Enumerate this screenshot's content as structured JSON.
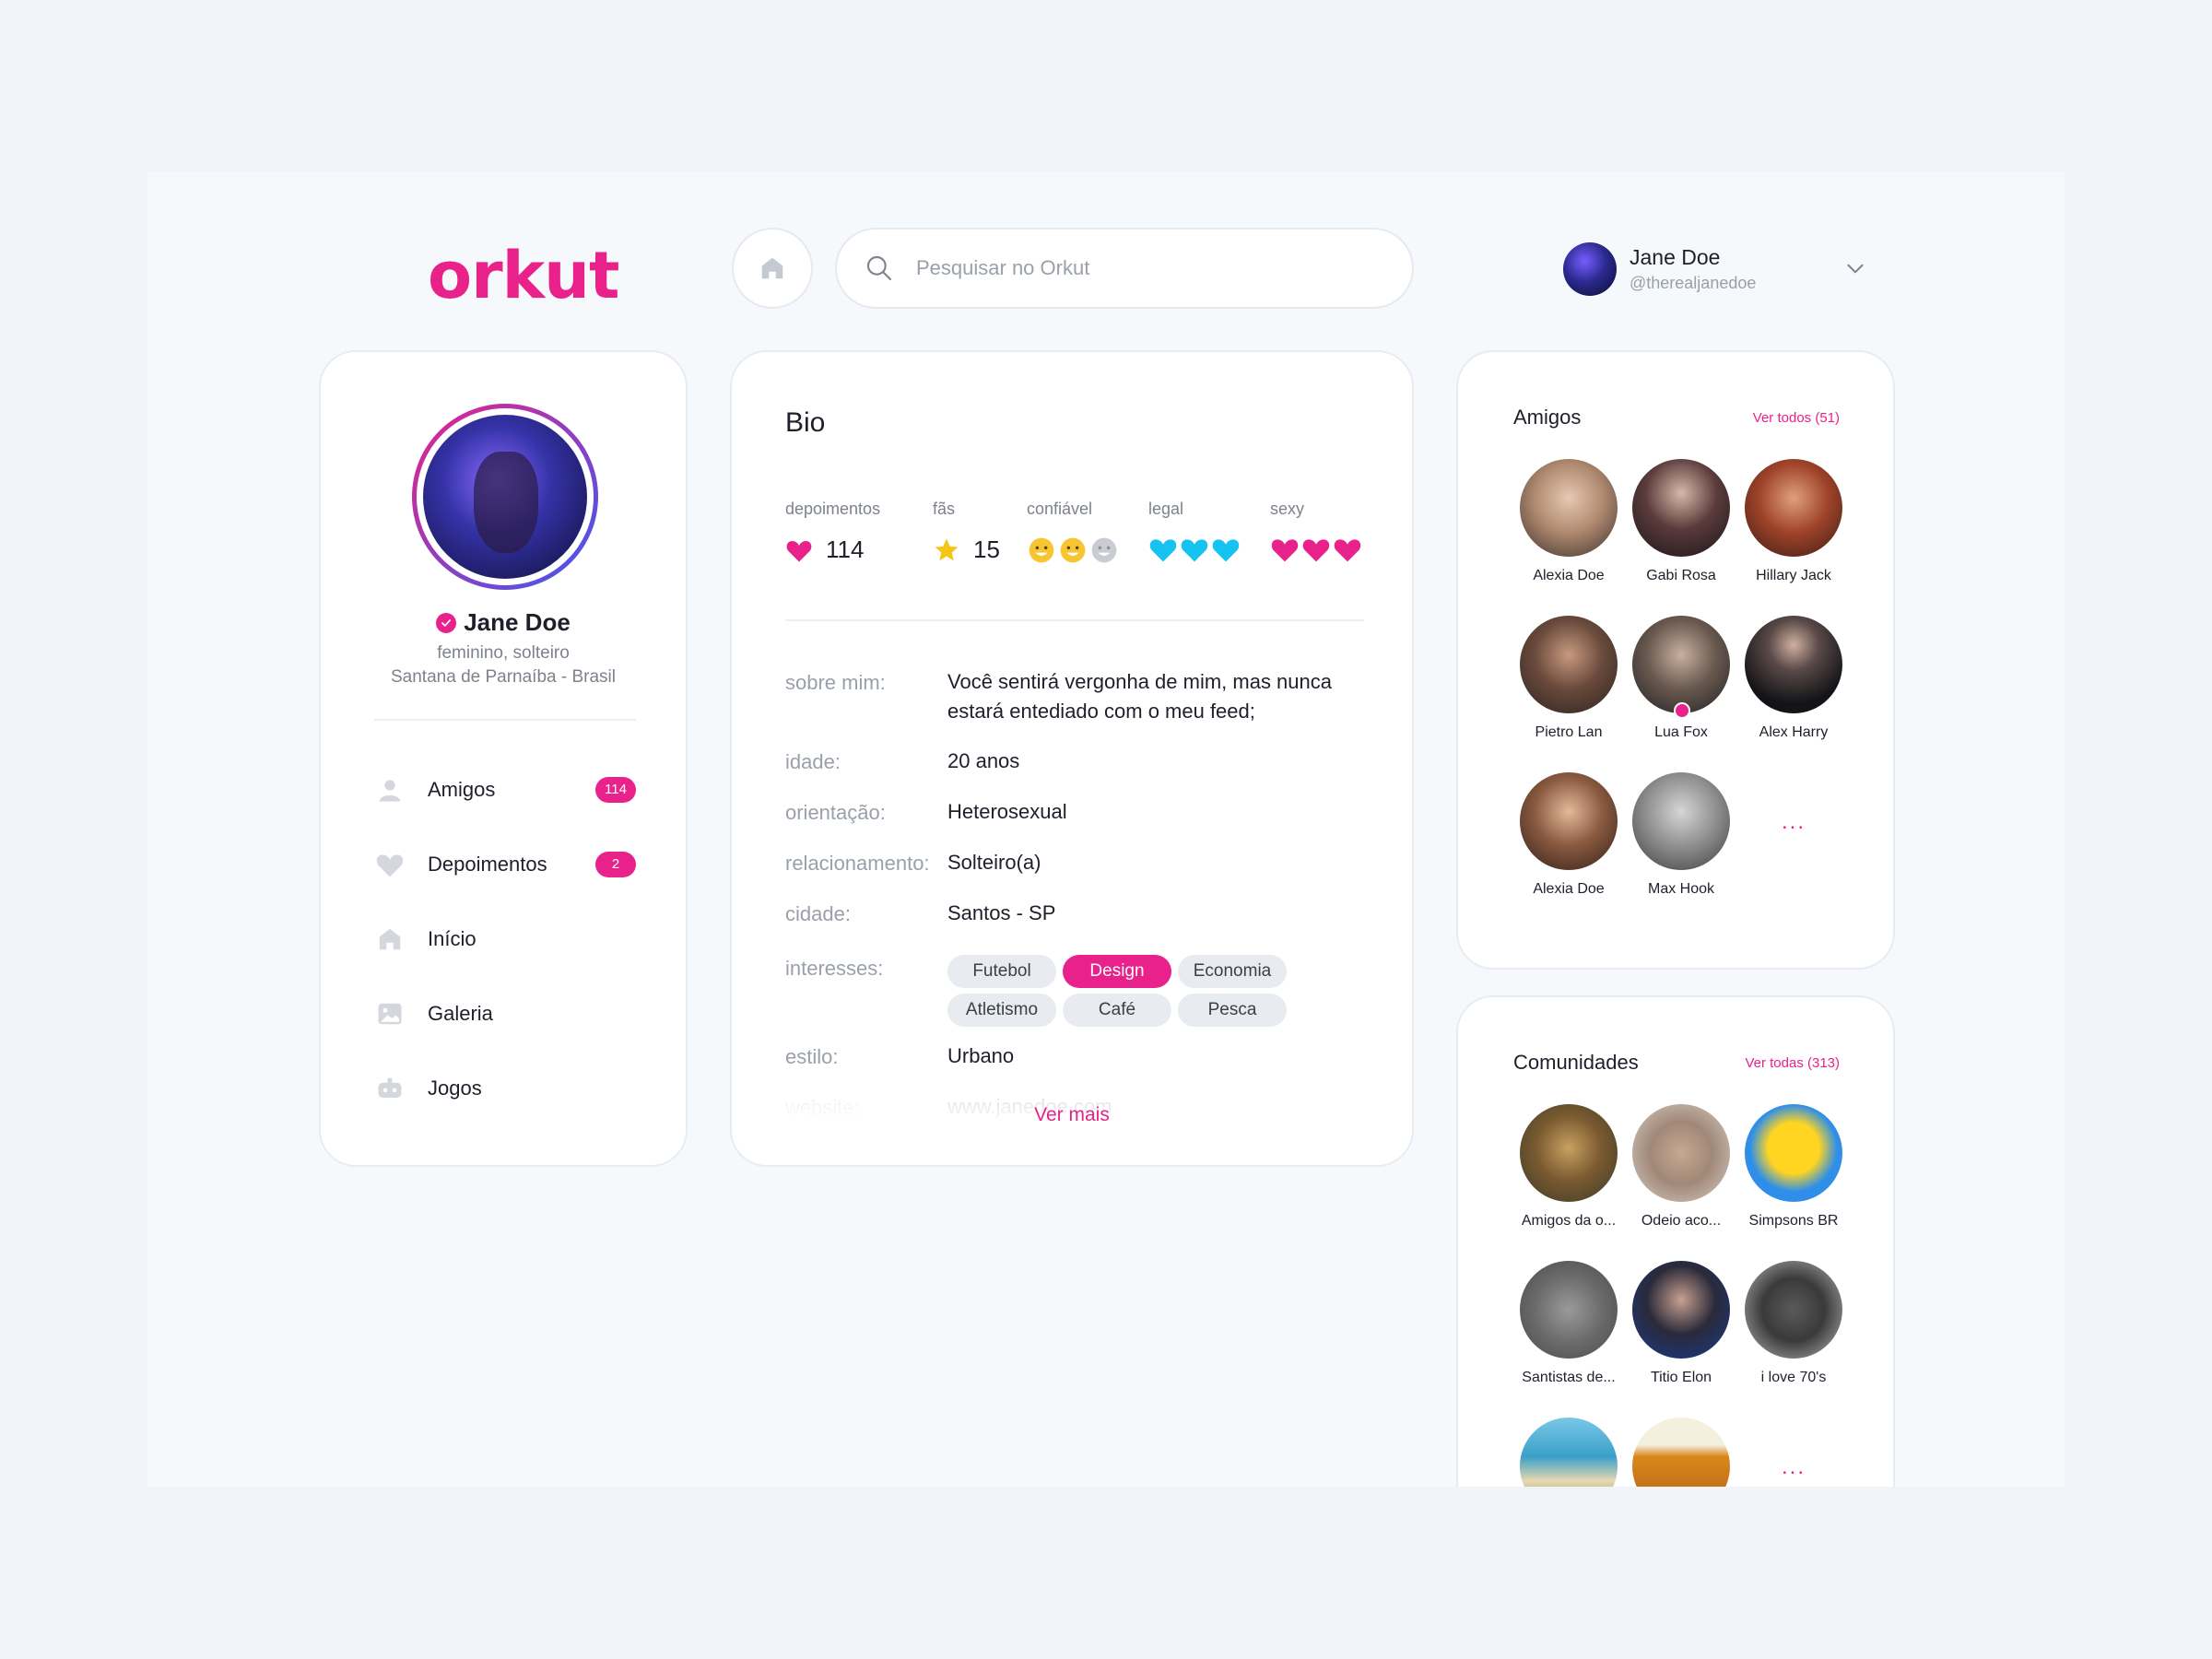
{
  "header": {
    "logo": "orkut",
    "search_placeholder": "Pesquisar no Orkut",
    "user_name": "Jane Doe",
    "user_handle": "@therealjanedoe"
  },
  "profile": {
    "name": "Jane Doe",
    "line1": "feminino, solteiro",
    "line2": "Santana de Parnaíba - Brasil"
  },
  "nav": {
    "items": [
      {
        "label": "Amigos",
        "badge": "114",
        "icon": "user-icon"
      },
      {
        "label": "Depoimentos",
        "badge": "2",
        "icon": "heart-icon"
      },
      {
        "label": "Início",
        "icon": "home-icon"
      },
      {
        "label": "Galeria",
        "icon": "image-icon"
      },
      {
        "label": "Jogos",
        "icon": "gamepad-icon"
      }
    ]
  },
  "bio": {
    "title": "Bio",
    "stats": [
      {
        "label": "depoimentos",
        "value": "114",
        "icon": "heart-icon"
      },
      {
        "label": "fãs",
        "value": "15",
        "icon": "star-icon"
      },
      {
        "label": "confiável",
        "level": 2,
        "max": 3,
        "icon": "smile-icon"
      },
      {
        "label": "legal",
        "level": 3,
        "max": 3,
        "icon": "blue-heart-icon"
      },
      {
        "label": "sexy",
        "level": 3,
        "max": 3,
        "icon": "pink-heart-icon"
      }
    ],
    "rows": {
      "sobre_k": "sobre mim:",
      "sobre_v": "Você sentirá vergonha de mim, mas nunca estará entediado com o meu feed;",
      "idade_k": "idade:",
      "idade_v": "20 anos",
      "orient_k": "orientação:",
      "orient_v": "Heterosexual",
      "rel_k": "relacionamento:",
      "rel_v": "Solteiro(a)",
      "cidade_k": "cidade:",
      "cidade_v": "Santos - SP",
      "interesses_k": "interesses:",
      "estilo_k": "estilo:",
      "estilo_v": "Urbano",
      "website_k": "website:",
      "website_v": "www.janedoe.com"
    },
    "interests": [
      "Futebol",
      "Design",
      "Economia",
      "Atletismo",
      "Café",
      "Pesca"
    ],
    "active_interest": "Design",
    "ver_mais": "Ver mais"
  },
  "friends": {
    "title": "Amigos",
    "link": "Ver todos (51)",
    "items": [
      "Alexia Doe",
      "Gabi Rosa",
      "Hillary Jack",
      "Pietro Lan",
      "Lua Fox",
      "Alex Harry",
      "Alexia Doe",
      "Max Hook"
    ],
    "more": "..."
  },
  "communities": {
    "title": "Comunidades",
    "link": "Ver todas (313)",
    "items": [
      "Amigos da o...",
      "Odeio aco...",
      "Simpsons BR",
      "Santistas de...",
      "Titio Elon",
      "i love 70's"
    ],
    "more": "..."
  },
  "colors": {
    "accent": "#e8228a",
    "legal": "#14c3f0",
    "star": "#f5c518",
    "smile": "#f7c531"
  }
}
